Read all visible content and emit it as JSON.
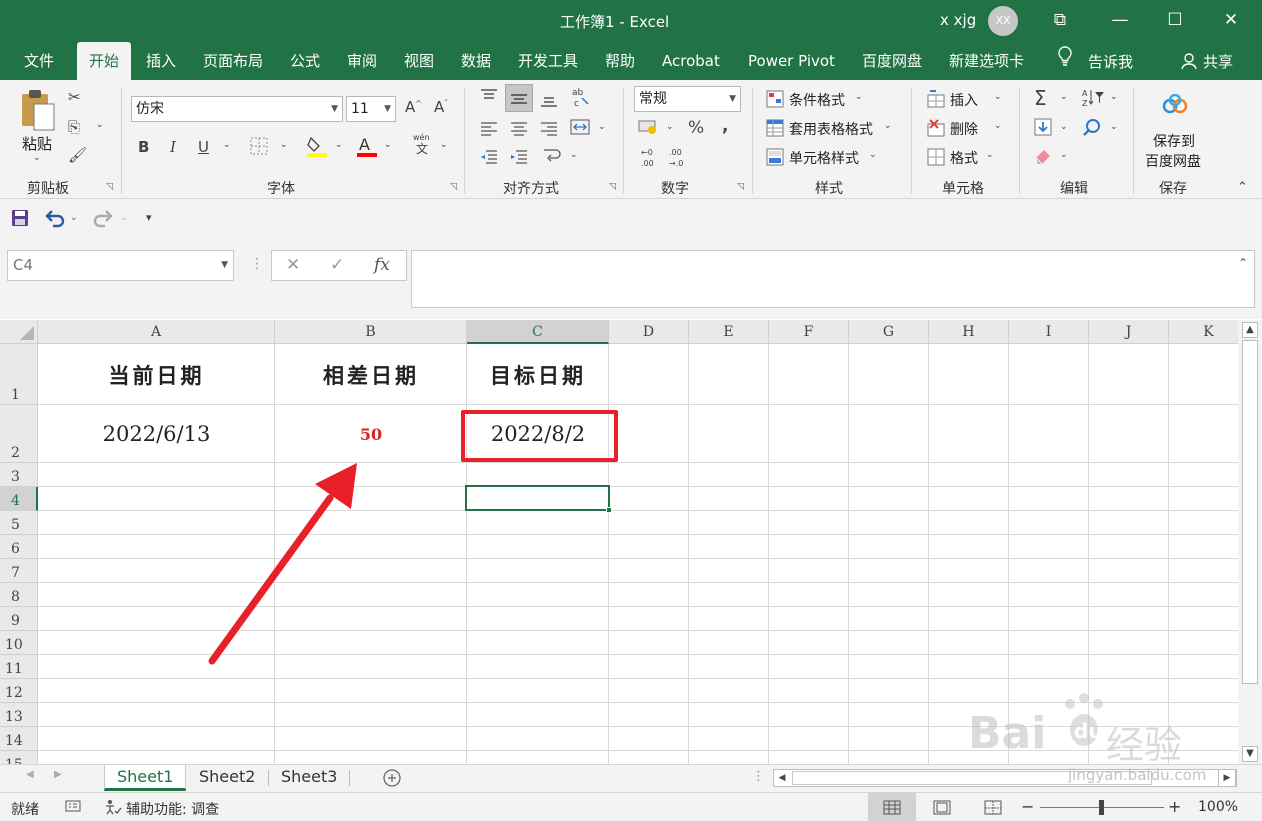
{
  "window": {
    "title": "工作簿1 - Excel",
    "user": "x xjg",
    "avatar_initials": "XX",
    "minimize": "—",
    "restore": "☐",
    "close": "✕",
    "ribbon_display": "⧉"
  },
  "ribbon_tabs": [
    "文件",
    "开始",
    "插入",
    "页面布局",
    "公式",
    "审阅",
    "视图",
    "数据",
    "开发工具",
    "帮助",
    "Acrobat",
    "Power Pivot",
    "百度网盘",
    "新建选项卡"
  ],
  "tell_me": "告诉我",
  "share": "共享",
  "ribbon": {
    "clipboard": {
      "paste": "粘贴",
      "label": "剪贴板"
    },
    "font": {
      "font_name": "仿宋",
      "font_size": "11",
      "label": "字体",
      "bold": "B",
      "italic": "I",
      "underline": "U"
    },
    "alignment": {
      "label": "对齐方式"
    },
    "number": {
      "format": "常规",
      "label": "数字",
      "percent": "%",
      "comma": ","
    },
    "styles": {
      "conditional": "条件格式",
      "table": "套用表格格式",
      "cell": "单元格样式",
      "label": "样式"
    },
    "cells": {
      "insert": "插入",
      "delete": "删除",
      "format": "格式",
      "label": "单元格"
    },
    "editing": {
      "label": "编辑"
    },
    "save": {
      "line1": "保存到",
      "line2": "百度网盘",
      "label": "保存"
    }
  },
  "formula_bar": {
    "name_box": "C4",
    "fx": "fx",
    "value": ""
  },
  "columns": [
    "A",
    "B",
    "C",
    "D",
    "E",
    "F",
    "G",
    "H",
    "I",
    "J",
    "K"
  ],
  "rows": [
    "1",
    "2",
    "3",
    "4",
    "5",
    "6",
    "7",
    "8",
    "9",
    "10",
    "11",
    "12",
    "13",
    "14",
    "15"
  ],
  "cells": {
    "A1": "当前日期",
    "B1": "相差日期",
    "C1": "目标日期",
    "A2": "2022/6/13",
    "B2": "50",
    "C2": "2022/8/2"
  },
  "colors": {
    "excel_green": "#217346",
    "accent_red": "#e8202a",
    "value_red": "#e02020"
  },
  "sheets": [
    "Sheet1",
    "Sheet2",
    "Sheet3"
  ],
  "status": {
    "ready": "就绪",
    "accessibility": "辅助功能: 调查",
    "zoom": "100%"
  },
  "watermark": {
    "brand": "Bai",
    "brand2": "经验",
    "url": "jingyan.baidu.com"
  }
}
